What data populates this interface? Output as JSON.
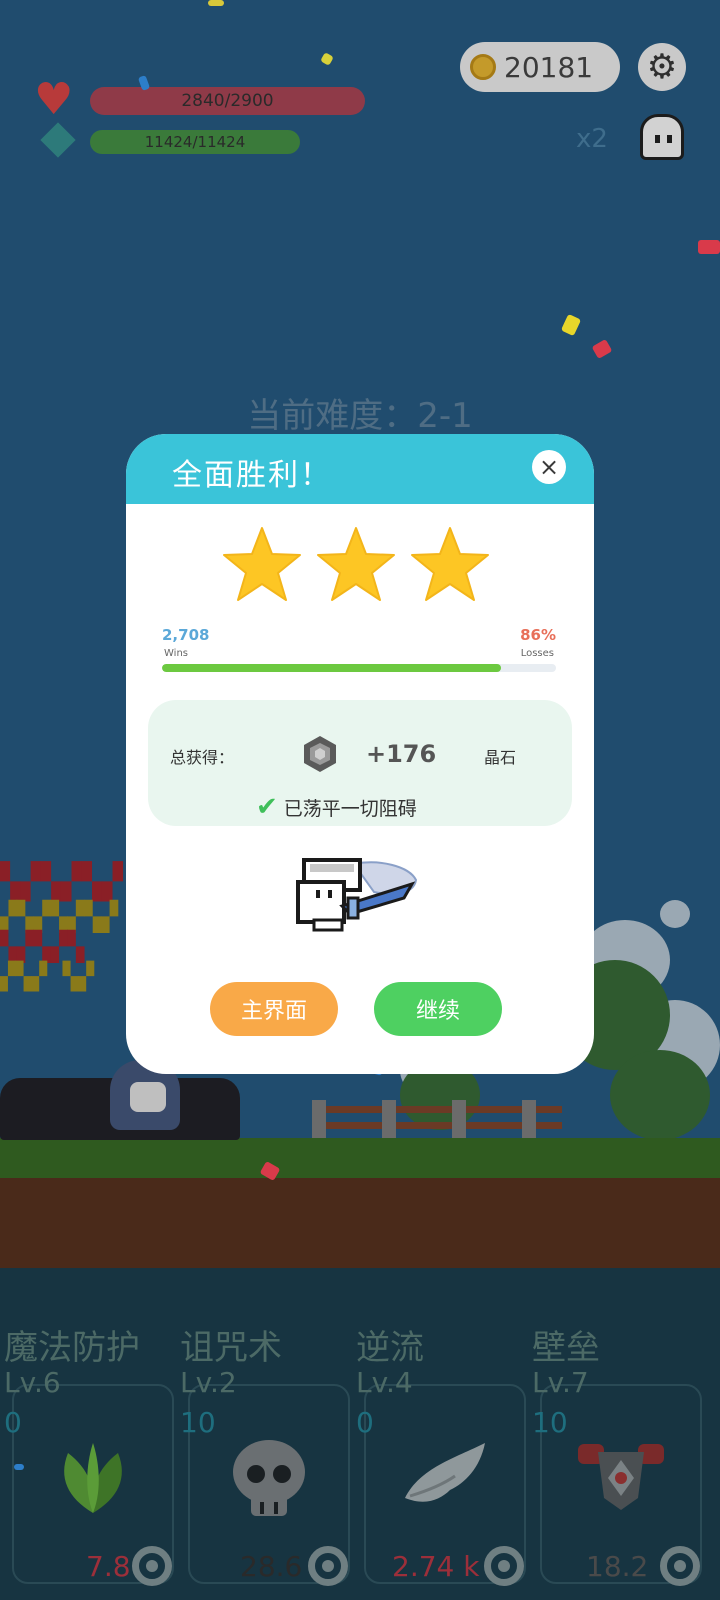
{
  "hud": {
    "coins": "20181",
    "hp": "2840/2900",
    "mp": "11424/11424",
    "multiplier": "x2"
  },
  "stage": {
    "difficulty": "当前难度：2-1"
  },
  "dialog": {
    "title": "全面胜利！",
    "close": "×",
    "stars": 3,
    "wins_value": "2,708",
    "wins_label": "Wins",
    "losses_value": "86%",
    "losses_label": "Losses",
    "progress_fraction": 0.86,
    "reward_label": "总获得：",
    "reward_amount": "+176",
    "reward_unit": "晶石",
    "cleared_text": "已荡平一切阻碍",
    "home_button": "主界面",
    "continue_button": "继续"
  },
  "skills": [
    {
      "name": "魔法防护",
      "level": "Lv.6",
      "count": "0",
      "cost": "7.8",
      "cost_color": "#9c2f3a",
      "icon": "leaf-icon"
    },
    {
      "name": "诅咒术",
      "level": "Lv.2",
      "count": "10",
      "cost": "28.6",
      "cost_color": "#2a2a2a",
      "icon": "skull-icon"
    },
    {
      "name": "逆流",
      "level": "Lv.4",
      "count": "0",
      "cost": "2.74 k",
      "cost_color": "#9c2f3a",
      "icon": "wing-icon"
    },
    {
      "name": "壁垒",
      "level": "Lv.7",
      "count": "10",
      "cost": "18.2",
      "cost_color": "#4a4a4a",
      "icon": "armor-icon"
    }
  ],
  "colors": {
    "dialog_header": "#3ac4d9",
    "home_button": "#f9a948",
    "continue_button": "#4ed061",
    "star": "#fdc624"
  }
}
